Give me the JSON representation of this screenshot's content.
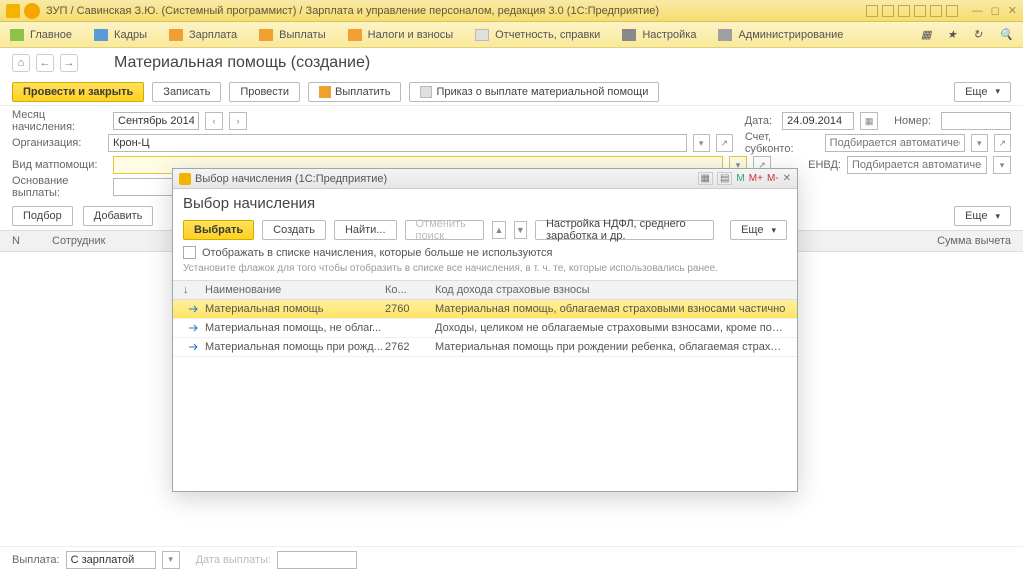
{
  "titlebar": {
    "text": "ЗУП / Савинская З.Ю. (Системный программист) / Зарплата и управление персоналом, редакция 3.0 (1С:Предприятие)"
  },
  "nav": {
    "main": "Главное",
    "hr": "Кадры",
    "salary": "Зарплата",
    "payments": "Выплаты",
    "taxes": "Налоги и взносы",
    "reports": "Отчетность, справки",
    "settings": "Настройка",
    "admin": "Администрирование"
  },
  "page": {
    "title": "Материальная помощь (создание)"
  },
  "toolbar": {
    "post_close": "Провести и закрыть",
    "write": "Записать",
    "post": "Провести",
    "pay": "Выплатить",
    "order": "Приказ о выплате материальной помощи",
    "more": "Еще"
  },
  "form": {
    "month_lbl": "Месяц начисления:",
    "month_val": "Сентябрь 2014",
    "date_lbl": "Дата:",
    "date_val": "24.09.2014",
    "num_lbl": "Номер:",
    "org_lbl": "Организация:",
    "org_val": "Крон-Ц",
    "acc_lbl": "Счет, субконто:",
    "acc_ph": "Подбирается автоматически",
    "type_lbl": "Вид матпомощи:",
    "envd_lbl": "ЕНВД:",
    "envd_ph": "Подбирается автоматически",
    "basis_lbl": "Основание выплаты:",
    "select": "Подбор",
    "add": "Добавить",
    "more2": "Еще",
    "col_n": "N",
    "col_emp": "Сотрудник",
    "col_sum": "Сумма вычета",
    "payout_lbl": "Выплата:",
    "payout_val": "С зарплатой",
    "payout_date_lbl": "Дата выплаты:"
  },
  "modal": {
    "wintitle": "Выбор начисления (1С:Предприятие)",
    "heading": "Выбор начисления",
    "select": "Выбрать",
    "create": "Создать",
    "find": "Найти...",
    "cancel_find": "Отменить поиск",
    "ndfl": "Настройка НДФЛ, среднего заработка и др.",
    "more": "Еще",
    "checkbox": "Отображать в списке начисления, которые больше не используются",
    "hint": "Установите флажок для того чтобы отобразить в списке все начисления, в т. ч. те, которые использовались ранее.",
    "col_name": "Наименование",
    "col_code": "Ко...",
    "col_desc": "Код дохода страховые взносы",
    "rows": [
      {
        "name": "Материальная помощь",
        "code": "2760",
        "desc": "Материальная помощь, облагаемая страховыми взносами частично"
      },
      {
        "name": "Материальная помощь, не облаг...",
        "code": "",
        "desc": "Доходы, целиком не облагаемые страховыми взносами, кроме пособий за счет ФСС и денежного довол..."
      },
      {
        "name": "Материальная помощь при рожд...",
        "code": "2762",
        "desc": "Материальная помощь при рождении ребенка, облагаемая страховыми взносами частично"
      }
    ]
  }
}
